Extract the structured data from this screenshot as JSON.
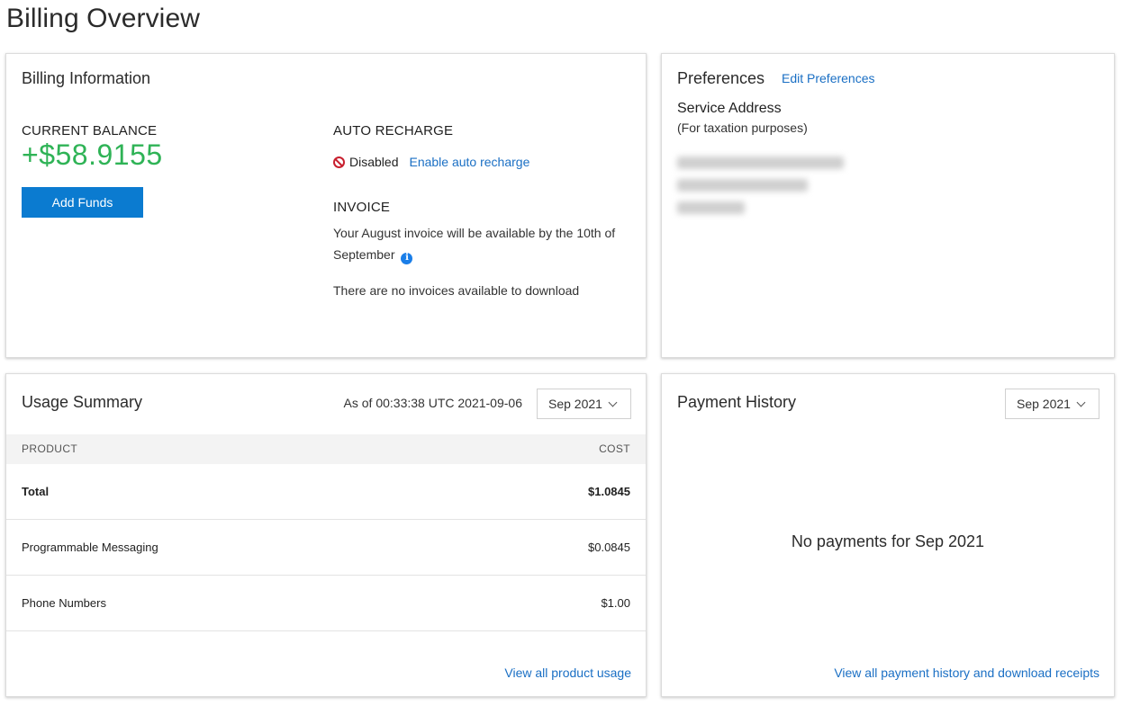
{
  "page": {
    "title": "Billing Overview"
  },
  "billing": {
    "title": "Billing Information",
    "balance_label": "CURRENT BALANCE",
    "balance_value": "+$58.9155",
    "add_funds_label": "Add Funds",
    "auto_recharge_label": "AUTO RECHARGE",
    "auto_recharge_status": "Disabled",
    "enable_link": "Enable auto recharge",
    "invoice_label": "INVOICE",
    "invoice_line1": "Your August invoice will be available by the 10th of",
    "invoice_line2": "September",
    "invoice_none": "There are no invoices available to download",
    "colors": {
      "balance": "#2fb356",
      "button": "#0b7bd0",
      "disabled_icon": "#c8202f"
    }
  },
  "preferences": {
    "title": "Preferences",
    "edit_link": "Edit Preferences",
    "service_label": "Service Address",
    "service_sub": "(For taxation purposes)"
  },
  "usage": {
    "title": "Usage Summary",
    "as_of": "As of 00:33:38 UTC 2021-09-06",
    "period": "Sep 2021",
    "columns": {
      "product": "PRODUCT",
      "cost": "COST"
    },
    "rows": [
      {
        "product": "Total",
        "cost": "$1.0845"
      },
      {
        "product": "Programmable Messaging",
        "cost": "$0.0845"
      },
      {
        "product": "Phone Numbers",
        "cost": "$1.00"
      }
    ],
    "view_all_link": "View all product usage"
  },
  "payment": {
    "title": "Payment History",
    "period": "Sep 2021",
    "empty_message": "No payments for Sep 2021",
    "view_all_link": "View all payment history and download receipts"
  }
}
